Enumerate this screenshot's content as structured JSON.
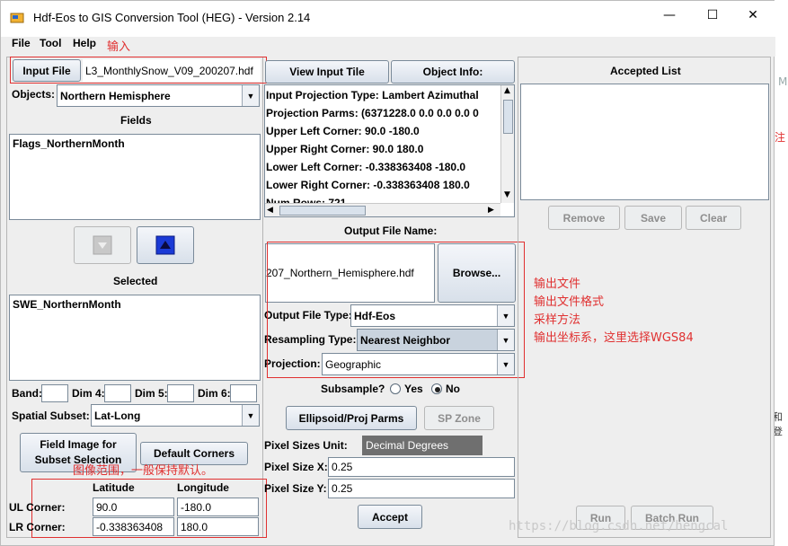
{
  "window": {
    "title": "Hdf-Eos to GIS Conversion Tool (HEG) - Version 2.14",
    "controls": {
      "minimize": "—",
      "maximize": "☐",
      "close": "✕"
    }
  },
  "menu": [
    "File",
    "Tool",
    "Help"
  ],
  "left": {
    "input_file_label": "Input File",
    "input_file_value": "L3_MonthlySnow_V09_200207.hdf",
    "objects_label": "Objects:",
    "objects_value": "Northern Hemisphere",
    "fields_title": "Fields",
    "fields_items": [
      "Flags_NorthernMonth"
    ],
    "selected_title": "Selected",
    "selected_items": [
      "SWE_NorthernMonth"
    ],
    "band_label": "Band:",
    "dim4_label": "Dim 4:",
    "dim5_label": "Dim 5:",
    "dim6_label": "Dim 6:",
    "spatial_subset_label": "Spatial Subset:",
    "spatial_subset_value": "Lat-Long",
    "field_image_button": "Field Image for Subset Selection",
    "default_corners_button": "Default Corners",
    "latitude_header": "Latitude",
    "longitude_header": "Longitude",
    "ul_corner_label": "UL Corner:",
    "lr_corner_label": "LR Corner:",
    "ul_lat": "90.0",
    "ul_lon": "-180.0",
    "lr_lat": "-0.338363408",
    "lr_lon": "180.0"
  },
  "middle": {
    "view_input_tile_button": "View Input Tile",
    "object_info_button": "Object Info:",
    "info_lines": [
      "Input Projection Type:  Lambert Azimuthal",
      "Projection Parms:  (6371228.0   0.0   0.0   0.0   0",
      "Upper Left Corner:  90.0    -180.0",
      "Upper Right Corner:  90.0    180.0",
      "Lower Left Corner:  -0.338363408    -180.0",
      "Lower Right Corner:  -0.338363408    180.0",
      "Num Rows:  721"
    ],
    "output_file_name_title": "Output File Name:",
    "output_file_value": "207_Northern_Hemisphere.hdf",
    "browse_button": "Browse...",
    "output_file_type_label": "Output File Type:",
    "output_file_type_value": "Hdf-Eos",
    "resampling_type_label": "Resampling Type:",
    "resampling_type_value": "Nearest Neighbor",
    "projection_label": "Projection:",
    "projection_value": "Geographic",
    "subsample_label": "Subsample?",
    "subsample_yes": "Yes",
    "subsample_no": "No",
    "subsample_selected": "No",
    "ellipsoid_button": "Ellipsoid/Proj Parms",
    "sp_zone_button": "SP Zone",
    "pixel_sizes_unit_label": "Pixel Sizes Unit:",
    "pixel_sizes_unit_value": "Decimal Degrees",
    "pixel_size_x_label": "Pixel Size X:",
    "pixel_size_x_value": "0.25",
    "pixel_size_y_label": "Pixel Size Y:",
    "pixel_size_y_value": "0.25",
    "accept_button": "Accept"
  },
  "right": {
    "accepted_list_title": "Accepted List",
    "remove_button": "Remove",
    "save_button": "Save",
    "clear_button": "Clear",
    "run_button": "Run",
    "batch_run_button": "Batch Run"
  },
  "annotations": {
    "input": "输入",
    "output_lines": [
      "输出文件",
      "输出文件格式",
      "采样方法",
      "输出坐标系，这里选择WGS84"
    ],
    "extent": "图像范围，一般保持默认。"
  },
  "watermark": "https://blog.csdn.net/hengcal",
  "background_fragments": {
    "right_1": "M",
    "right_2": "注",
    "right_3": "和登"
  },
  "colors": {
    "annotation_red": "#e03030",
    "arrow_blue": "#1a3ad6",
    "titlebar": "#ffffff"
  }
}
